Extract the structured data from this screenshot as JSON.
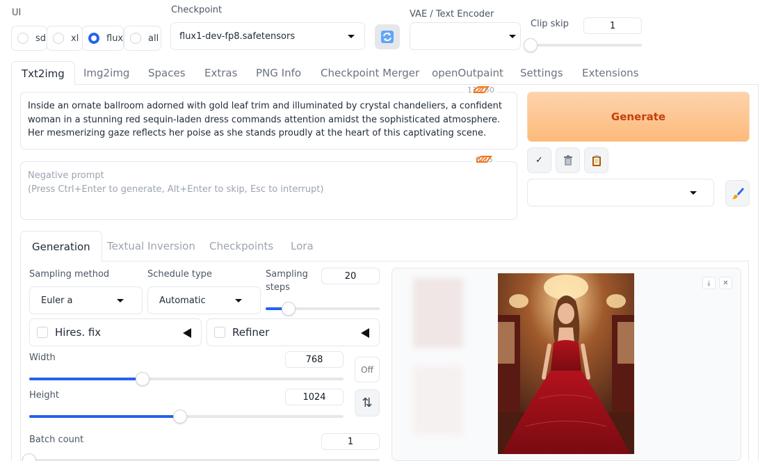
{
  "top": {
    "ui_label": "UI",
    "ui_options": [
      "sd",
      "xl",
      "flux",
      "all"
    ],
    "ui_selected": "flux",
    "checkpoint_label": "Checkpoint",
    "checkpoint_value": "flux1-dev-fp8.safetensors",
    "refresh_icon": "refresh-icon",
    "vae_label": "VAE / Text Encoder",
    "vae_value": "",
    "clip_skip_label": "Clip skip",
    "clip_skip_value": "1",
    "clip_skip_fraction": 0.0
  },
  "tabs": [
    "Txt2img",
    "Img2img",
    "Spaces",
    "Extras",
    "PNG Info",
    "Checkpoint Merger",
    "openOutpaint",
    "Settings",
    "Extensions"
  ],
  "active_tab": "Txt2img",
  "prompt": {
    "text": "Inside an ornate ballroom adorned with gold leaf trim and illuminated by crystal chandeliers, a confident woman in a stunning red sequin-laden dress commands attention amidst the sophisticated atmosphere. Her mesmerizing gaze reflects her poise as she stands proudly at the heart of this captivating scene.",
    "token_count": "13/150"
  },
  "negative_prompt": {
    "placeholder_line1": "Negative prompt",
    "placeholder_line2": "(Press Ctrl+Enter to generate, Alt+Enter to skip, Esc to interrupt)",
    "token_count": "0/75"
  },
  "generate_label": "Generate",
  "tool_buttons": {
    "check": "✓",
    "trash": "🗑",
    "clipboard": "📋",
    "brush": "🖌"
  },
  "styles_value": "",
  "subtabs": [
    "Generation",
    "Textual Inversion",
    "Checkpoints",
    "Lora"
  ],
  "active_subtab": "Generation",
  "generation": {
    "sampling_method_label": "Sampling method",
    "sampling_method_value": "Euler a",
    "schedule_type_label": "Schedule type",
    "schedule_type_value": "Automatic",
    "sampling_steps_label_1": "Sampling",
    "sampling_steps_label_2": "steps",
    "sampling_steps_value": "20",
    "sampling_steps_fraction": 0.2,
    "hires_label": "Hires. fix",
    "refiner_label": "Refiner",
    "width_label": "Width",
    "width_value": "768",
    "width_fraction": 0.36,
    "height_label": "Height",
    "height_value": "1024",
    "height_fraction": 0.48,
    "off_label": "Off",
    "swap_icon": "⇅",
    "batch_count_label": "Batch count",
    "batch_count_value": "1",
    "batch_count_fraction": 0.0
  },
  "gallery": {
    "download_icon": "⤓",
    "close_icon": "✕"
  },
  "colors": {
    "accent": "#2563eb",
    "generate_bg": "#fdba7a",
    "generate_text": "#c2410c"
  }
}
